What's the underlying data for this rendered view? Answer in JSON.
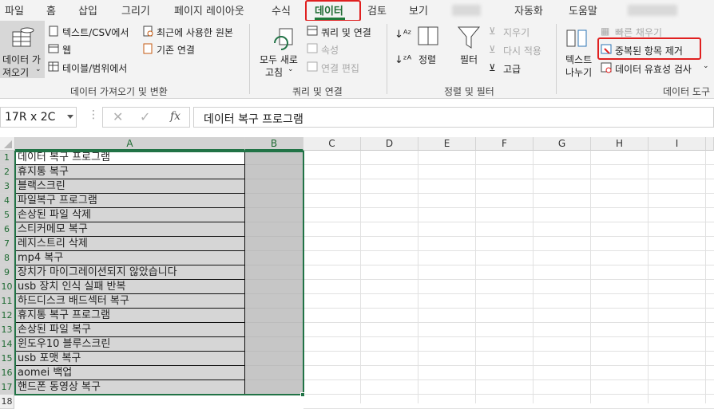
{
  "tabs": [
    "파일",
    "홈",
    "삽입",
    "그리기",
    "페이지 레이아웃",
    "수식",
    "데이터",
    "검토",
    "보기",
    "자동화",
    "도움말"
  ],
  "ribbon": {
    "get_data": {
      "line1": "데이터 가",
      "line2": "져오기"
    },
    "text_csv": "텍스트/CSV에서",
    "web": "웹",
    "table_range": "테이블/범위에서",
    "recent_sources": "최근에 사용한 원본",
    "existing_conn": "기존 연결",
    "group1_label": "데이터 가져오기 및 변환",
    "refresh_all": {
      "line1": "모두 새로",
      "line2": "고침"
    },
    "queries_conn": "쿼리 및 연결",
    "properties": "속성",
    "edit_links": "연결 편집",
    "group2_label": "쿼리 및 연결",
    "sort_label": "정렬",
    "filter_label": "필터",
    "clear": "지우기",
    "reapply": "다시 적용",
    "advanced": "고급",
    "group3_label": "정렬 및 필터",
    "text_to_cols": {
      "line1": "텍스트",
      "line2": "나누기"
    },
    "flash_fill": "빠른 채우기",
    "remove_dup": "중복된 항목 제거",
    "data_validation": "데이터 유효성 검사",
    "group4_label": "데이터 도구"
  },
  "formula_bar": {
    "name_box": "17R x 2C",
    "fx": "fx",
    "content": "데이터 복구 프로그램"
  },
  "columns": [
    "A",
    "B",
    "C",
    "D",
    "E",
    "F",
    "G",
    "H",
    "I"
  ],
  "rows": [
    {
      "num": "1",
      "a": "데이터 복구 프로그램"
    },
    {
      "num": "2",
      "a": "휴지통 복구"
    },
    {
      "num": "3",
      "a": "블랙스크린"
    },
    {
      "num": "4",
      "a": "파일복구 프로그램"
    },
    {
      "num": "5",
      "a": "손상된 파일 삭제"
    },
    {
      "num": "6",
      "a": "스티커메모 복구"
    },
    {
      "num": "7",
      "a": "레지스트리 삭제"
    },
    {
      "num": "8",
      "a": "mp4 복구"
    },
    {
      "num": "9",
      "a": "장치가 마이그레이션되지 않았습니다"
    },
    {
      "num": "10",
      "a": "usb 장치 인식 실패 반복"
    },
    {
      "num": "11",
      "a": "하드디스크 배드섹터 복구"
    },
    {
      "num": "12",
      "a": "휴지통 복구 프로그램"
    },
    {
      "num": "13",
      "a": "손상된 파일 복구"
    },
    {
      "num": "14",
      "a": "윈도우10 블루스크린"
    },
    {
      "num": "15",
      "a": "usb 포맷 복구"
    },
    {
      "num": "16",
      "a": "aomei 백업"
    },
    {
      "num": "17",
      "a": "핸드폰 동영상 복구"
    },
    {
      "num": "18",
      "a": ""
    }
  ]
}
